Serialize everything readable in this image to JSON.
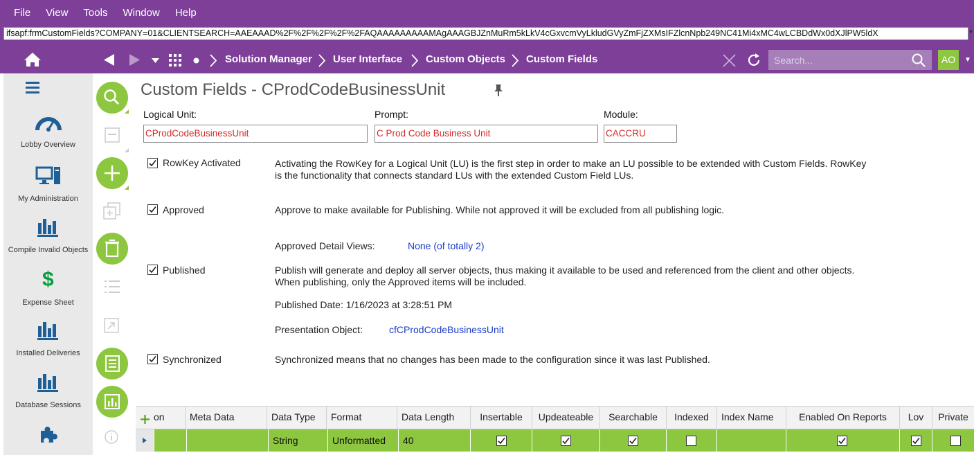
{
  "menu": [
    "File",
    "View",
    "Tools",
    "Window",
    "Help"
  ],
  "address": "ifsapf:frmCustomFields?COMPANY=01&CLIENTSEARCH=AAEAAAD%2F%2F%2F%2F%2FAQAAAAAAAAAMAgAAAGBJZnMuRm5kLkV4cGxvcmVyLkludGVyZmFjZXMsIFZlcnNpb249NC41Mi4xMC4wLCBDdWx0dXJlPW5ldX",
  "breadcrumb": [
    "Solution Manager",
    "User Interface",
    "Custom Objects",
    "Custom Fields"
  ],
  "search": {
    "placeholder": "Search..."
  },
  "user": {
    "initials": "AO"
  },
  "sidebar": [
    {
      "label": "Lobby Overview",
      "icon": "speedometer-icon"
    },
    {
      "label": "My Administration",
      "icon": "computer-icon"
    },
    {
      "label": "Compile Invalid Objects",
      "icon": "bar-chart-icon"
    },
    {
      "label": "Expense Sheet",
      "icon": "dollar-icon"
    },
    {
      "label": "Installed Deliveries",
      "icon": "bar-chart-icon"
    },
    {
      "label": "Database Sessions",
      "icon": "bar-chart-icon"
    },
    {
      "label": "",
      "icon": "puzzle-icon"
    }
  ],
  "page": {
    "title": "Custom Fields - CProdCodeBusinessUnit",
    "logical_unit_label": "Logical Unit:",
    "logical_unit": "CProdCodeBusinessUnit",
    "prompt_label": "Prompt:",
    "prompt": "C Prod Code Business Unit",
    "module_label": "Module:",
    "module": "CACCRU"
  },
  "options": {
    "rowkey": {
      "label": "RowKey Activated",
      "checked": true,
      "desc1": "Activating the RowKey for a Logical Unit (LU) is the first step in order to make an LU possible to be extended with Custom Fields. RowKey",
      "desc2": "is the functionality that connects standard LUs with the extended Custom Field LUs."
    },
    "approved": {
      "label": "Approved",
      "checked": true,
      "desc": "Approve to make available for Publishing. While not approved it will be excluded from all publishing logic.",
      "detail_label": "Approved Detail Views:",
      "detail_value": "None (of totally 2)"
    },
    "published": {
      "label": "Published",
      "checked": true,
      "desc1": "Publish will generate and deploy all server objects, thus making it available to be used and referenced from the client and other objects.",
      "desc2": "When publishing, only the Approved items will be included.",
      "date": "Published Date: 1/16/2023 at 3:28:51 PM",
      "po_label": "Presentation Object:",
      "po_value": "cfCProdCodeBusinessUnit"
    },
    "synchronized": {
      "label": "Synchronized",
      "checked": true,
      "desc": "Synchronized means that no changes has been made to the configuration since it was last Published."
    }
  },
  "grid": {
    "columns": [
      "on",
      "Meta Data",
      "Data Type",
      "Format",
      "Data Length",
      "Insertable",
      "Updeateable",
      "Searchable",
      "Indexed",
      "Index Name",
      "Enabled On Reports",
      "Lov",
      "Private"
    ],
    "row": {
      "on": "",
      "meta_data": "",
      "data_type": "String",
      "format": "Unformatted",
      "data_length": "40",
      "insertable": true,
      "updateable": true,
      "searchable": true,
      "indexed": false,
      "index_name": "",
      "enabled_on_reports": true,
      "lov": true,
      "private": false
    }
  },
  "colors": {
    "brand": "#7d3f98",
    "accent": "#8dc63f",
    "field_text": "#d42a2a",
    "link": "#1a3cc8"
  }
}
